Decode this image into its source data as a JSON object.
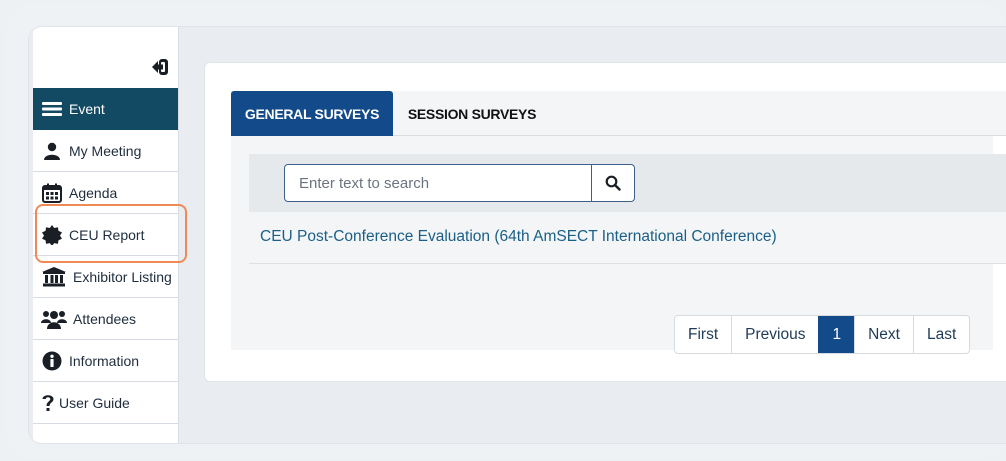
{
  "sidebar": {
    "items": [
      {
        "label": "Event",
        "icon": "hamburger-menu-icon",
        "active": true
      },
      {
        "label": "My Meeting",
        "icon": "user-icon"
      },
      {
        "label": "Agenda",
        "icon": "calendar-icon"
      },
      {
        "label": "CEU Report",
        "icon": "certificate-badge-icon"
      },
      {
        "label": "Exhibitor Listing",
        "icon": "bank-building-icon"
      },
      {
        "label": "Attendees",
        "icon": "users-group-icon"
      },
      {
        "label": "Information",
        "icon": "info-circle-icon"
      },
      {
        "label": "User Guide",
        "icon": "question-mark-icon"
      }
    ]
  },
  "tabs": [
    {
      "label": "GENERAL SURVEYS",
      "active": true
    },
    {
      "label": "SESSION SURVEYS",
      "active": false
    }
  ],
  "search": {
    "placeholder": "Enter text to search"
  },
  "results": [
    {
      "title": "CEU Post-Conference Evaluation (64th AmSECT International Conference)"
    }
  ],
  "pagination": {
    "first": "First",
    "previous": "Previous",
    "current": "1",
    "next": "Next",
    "last": "Last"
  },
  "colors": {
    "sidebar_active": "#134a63",
    "tab_active": "#134a8a",
    "link": "#1b5f86",
    "highlight": "#ef8a56"
  }
}
